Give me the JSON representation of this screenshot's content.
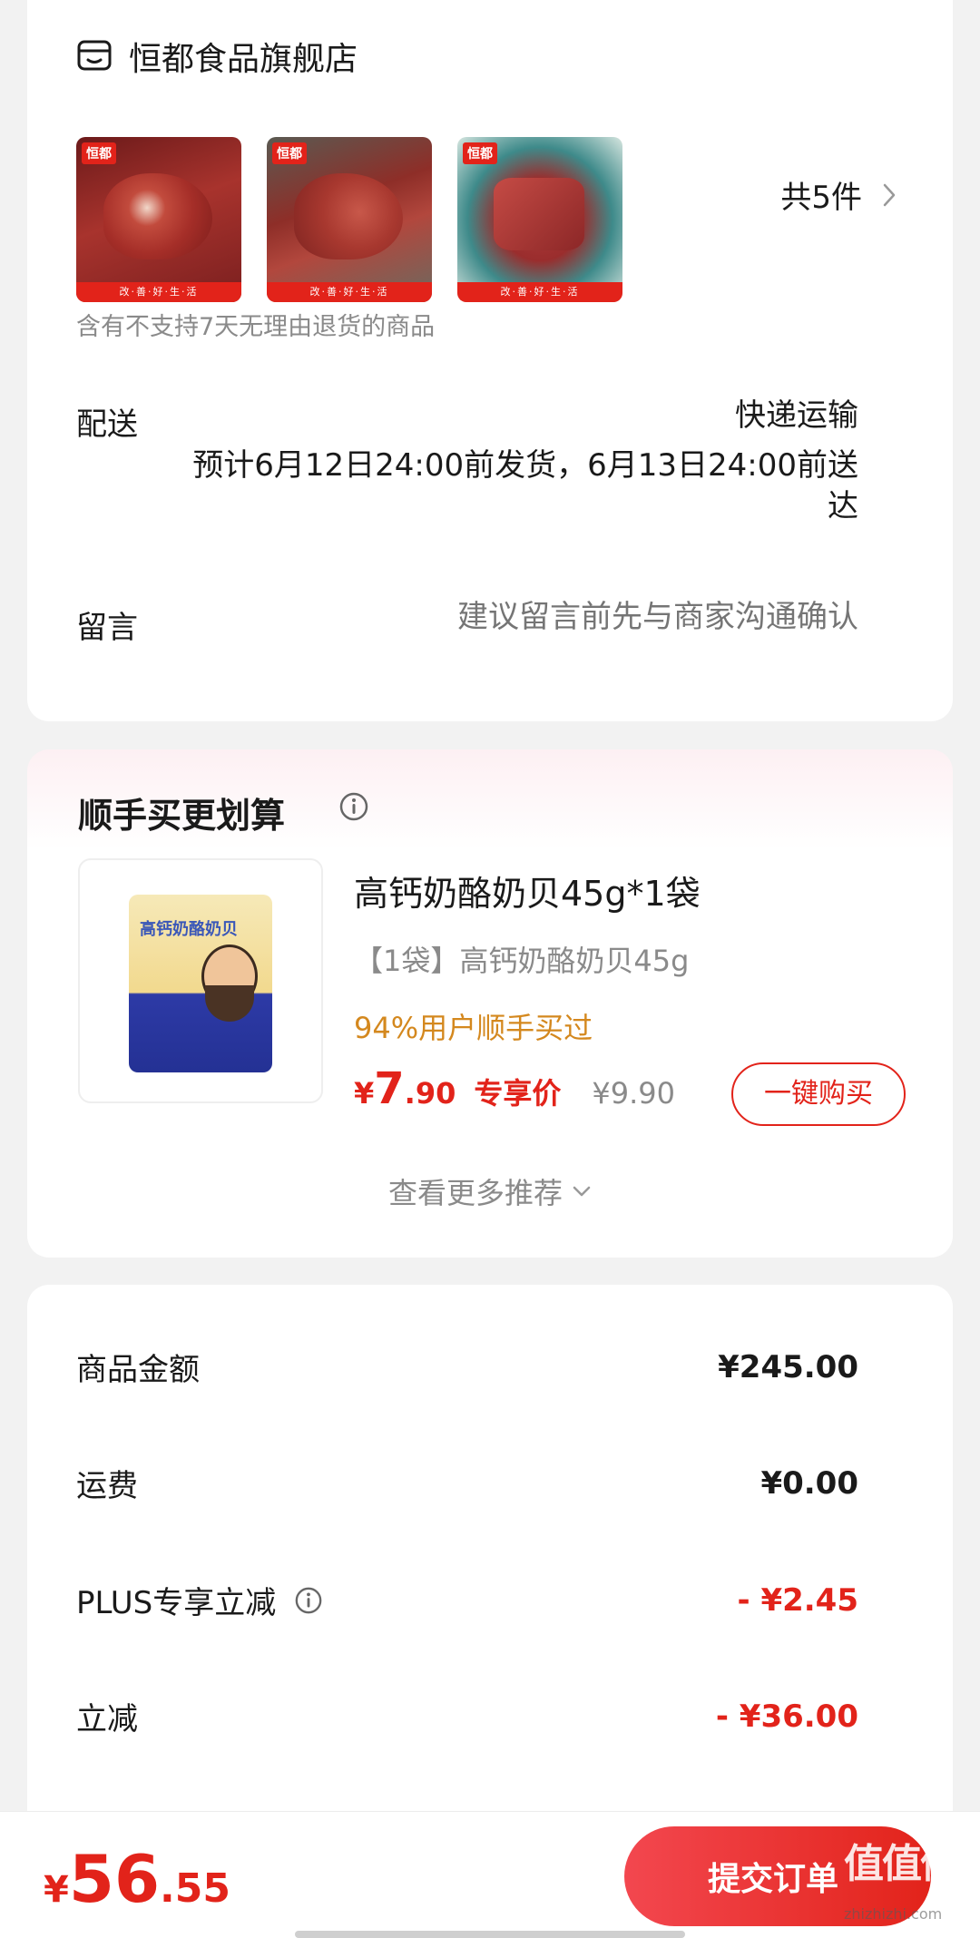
{
  "store": {
    "name": "恒都食品旗舰店",
    "item_count": "共5件",
    "thumb_brand": "恒都",
    "thumb_footer": "改·善·好·生·活",
    "notice": "含有不支持7天无理由退货的商品"
  },
  "delivery": {
    "label": "配送",
    "method": "快递运输",
    "estimate": "预计6月12日24:00前发货，6月13日24:00前送达"
  },
  "message": {
    "label": "留言",
    "placeholder": "建议留言前先与商家沟通确认"
  },
  "recommend": {
    "title": "顺手买更划算",
    "product": {
      "name": "高钙奶酪奶贝45g*1袋",
      "spec": "【1袋】高钙奶酪奶贝45g",
      "social_proof": "94%用户顺手买过",
      "price_yen": "¥",
      "price_int": "7",
      "price_dec": ".90",
      "price_label": "专享价",
      "original_price": "¥9.90",
      "buy_label": "一键购买",
      "bag_text": "高钙奶酪奶贝"
    },
    "more_label": "查看更多推荐"
  },
  "summary": {
    "rows": [
      {
        "label": "商品金额",
        "value": "¥245.00"
      },
      {
        "label": "运费",
        "value": "¥0.00"
      },
      {
        "label": "PLUS专享立减",
        "value": "- ¥2.45"
      },
      {
        "label": "立减",
        "value": "- ¥36.00"
      }
    ]
  },
  "footer": {
    "total_yen": "¥",
    "total_int": "56",
    "total_dec": ".55",
    "submit_label": "提交订单"
  },
  "watermark": {
    "text": "值值值",
    "url": "zhizhizhi.com"
  },
  "colors": {
    "accent_red": "#e2231a",
    "social_orange": "#d4881e",
    "muted_gray": "#8a8a8a"
  }
}
